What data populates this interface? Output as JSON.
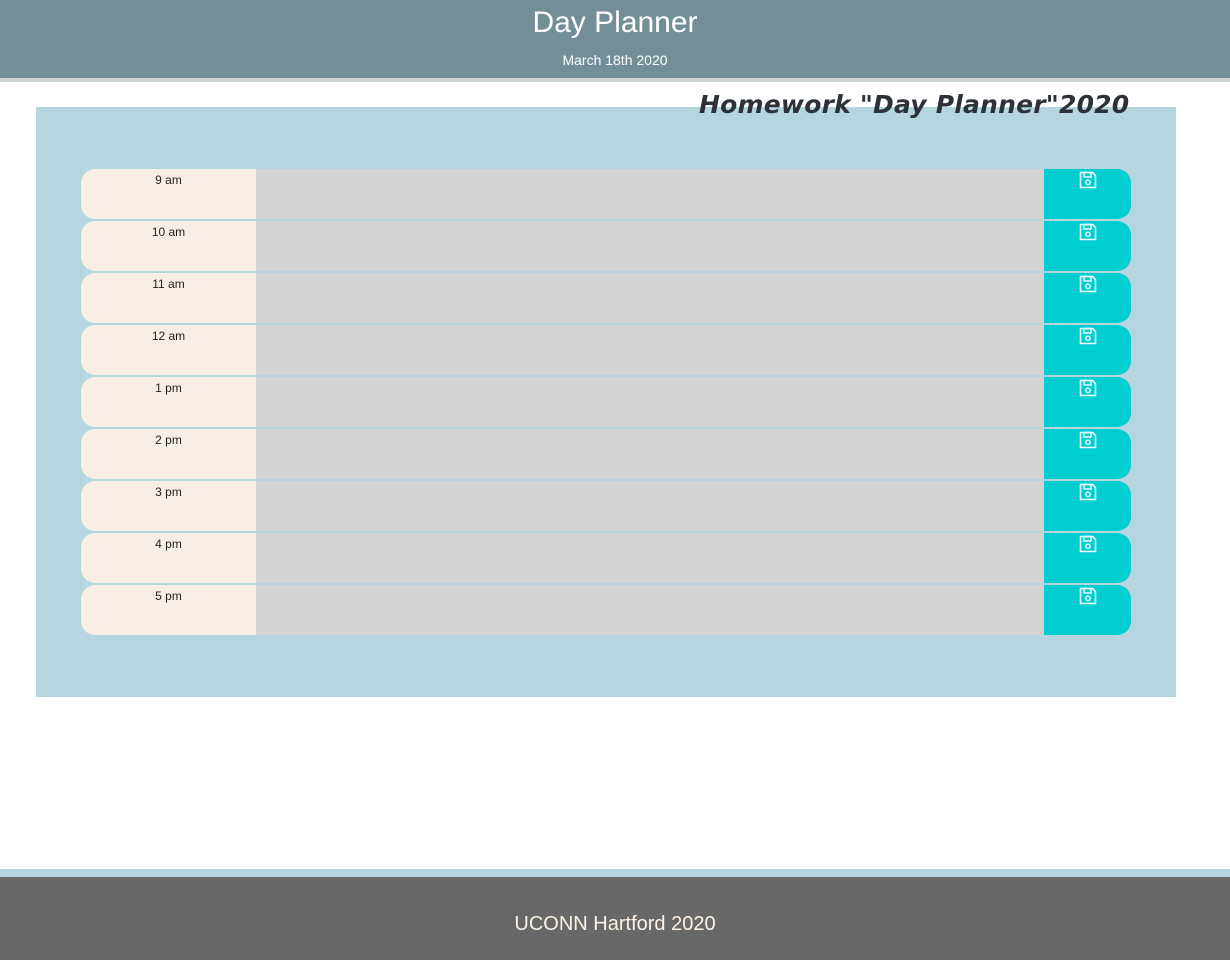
{
  "header": {
    "title": "Day Planner",
    "date": "March 18th 2020"
  },
  "main": {
    "heading": "Homework \"Day Planner\"2020",
    "rows": [
      {
        "hour": "9 am",
        "description": ""
      },
      {
        "hour": "10 am",
        "description": ""
      },
      {
        "hour": "11 am",
        "description": ""
      },
      {
        "hour": "12 am",
        "description": ""
      },
      {
        "hour": "1 pm",
        "description": ""
      },
      {
        "hour": "2 pm",
        "description": ""
      },
      {
        "hour": "3 pm",
        "description": ""
      },
      {
        "hour": "4 pm",
        "description": ""
      },
      {
        "hour": "5 pm",
        "description": ""
      }
    ],
    "save_icon": "save-icon"
  },
  "footer": {
    "text": "UCONN Hartford 2020"
  },
  "colors": {
    "header_bg": "#728f98",
    "panel_bg": "#b5d6df",
    "hour_bg": "#f9eee6",
    "description_bg": "#d3d3d3",
    "save_bg": "#00ced1",
    "footer_bg": "#686868"
  }
}
